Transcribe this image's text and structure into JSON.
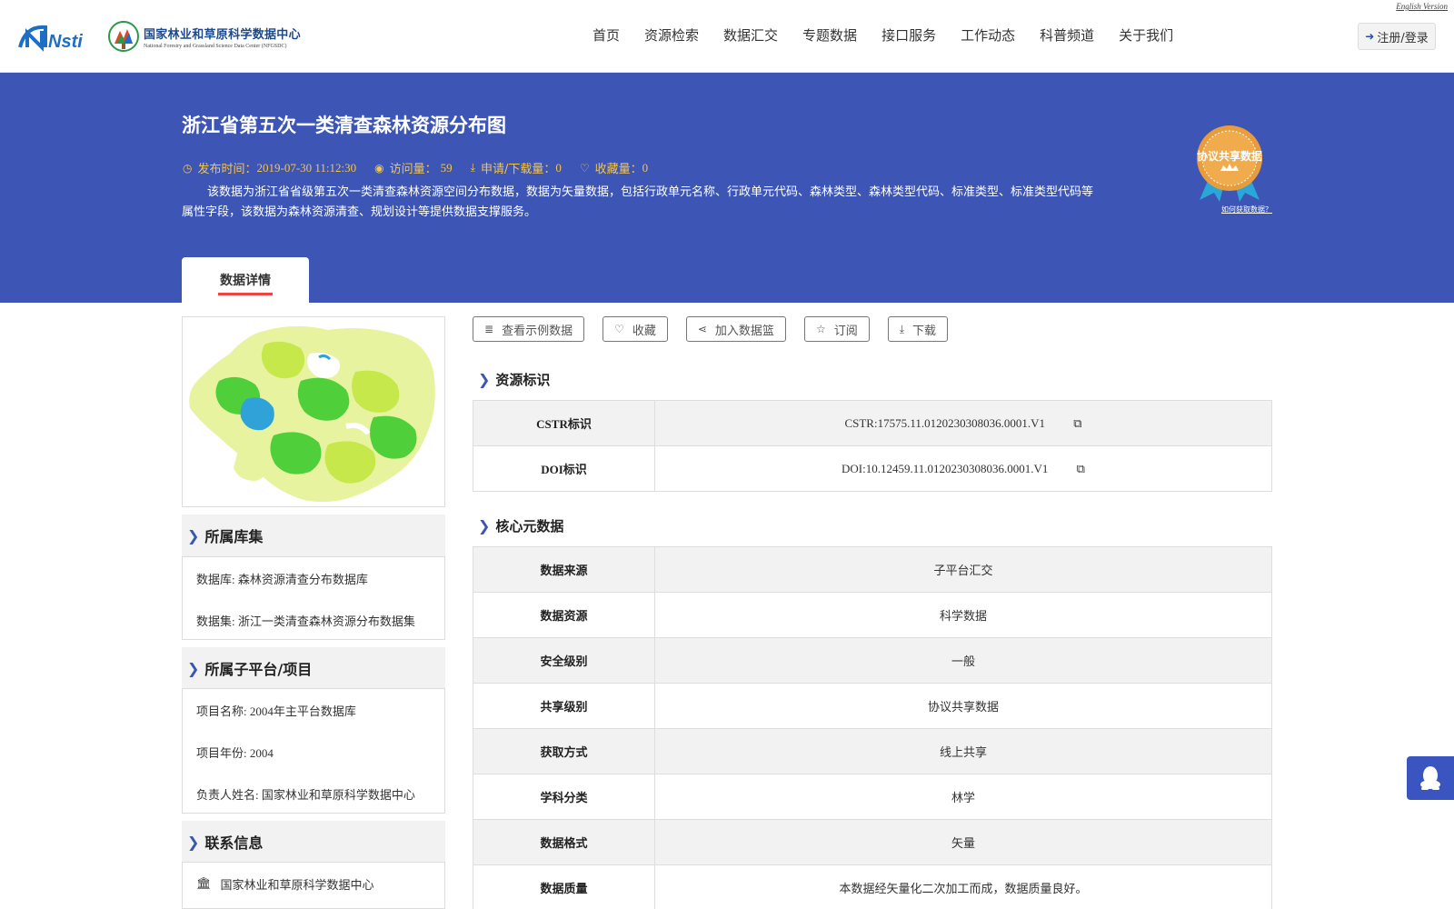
{
  "header": {
    "logo_text": "Nsti",
    "org_cn": "国家林业和草原科学数据中心",
    "org_en": "National Forestry and Grassland Science Data Center (NFGSDC)",
    "english_link": "English Version",
    "login_label": "注册/登录",
    "nav": [
      "首页",
      "资源检索",
      "数据汇交",
      "专题数据",
      "接口服务",
      "工作动态",
      "科普频道",
      "关于我们"
    ]
  },
  "banner": {
    "title": "浙江省第五次一类清查森林资源分布图",
    "publish_label": "发布时间：",
    "publish_time": "2019-07-30 11:12:30",
    "visits_label": "访问量：",
    "visits": "59",
    "downloads_label": "申请/下载量：",
    "downloads": "0",
    "favorites_label": "收藏量：",
    "favorites": "0",
    "description": "该数据为浙江省省级第五次一类清查森林资源空间分布数据，数据为矢量数据，包括行政单元名称、行政单元代码、森林类型、森林类型代码、标准类型、标准类型代码等属性字段，该数据为森林资源清查、规划设计等提供数据支撑服务。",
    "badge_label": "协议共享数据",
    "badge_link": "如何获取数据？",
    "tab_label": "数据详情"
  },
  "actions": [
    "查看示例数据",
    "收藏",
    "加入数据篮",
    "订阅",
    "下载"
  ],
  "sidebar": {
    "collection_title": "所属库集",
    "collection": [
      "数据库: 森林资源清查分布数据库",
      "数据集: 浙江一类清查森林资源分布数据集"
    ],
    "project_title": "所属子平台/项目",
    "project": [
      "项目名称: 2004年主平台数据库",
      "项目年份: 2004",
      "负责人姓名: 国家林业和草原科学数据中心"
    ],
    "contact_title": "联系信息",
    "contact_org": "国家林业和草原科学数据中心"
  },
  "resource_id": {
    "title": "资源标识",
    "rows": [
      {
        "key": "CSTR标识",
        "value": "CSTR:17575.11.0120230308036.0001.V1"
      },
      {
        "key": "DOI标识",
        "value": "DOI:10.12459.11.0120230308036.0001.V1"
      }
    ]
  },
  "core_meta": {
    "title": "核心元数据",
    "rows": [
      {
        "key": "数据来源",
        "value": "子平台汇交"
      },
      {
        "key": "数据资源",
        "value": "科学数据"
      },
      {
        "key": "安全级别",
        "value": "一般"
      },
      {
        "key": "共享级别",
        "value": "协议共享数据"
      },
      {
        "key": "获取方式",
        "value": "线上共享"
      },
      {
        "key": "学科分类",
        "value": "林学"
      },
      {
        "key": "数据格式",
        "value": "矢量"
      },
      {
        "key": "数据质量",
        "value": "本数据经矢量化二次加工而成，数据质量良好。"
      }
    ]
  },
  "colors": {
    "banner": "#3d56b6",
    "meta_yellow": "#f5c546",
    "accent_red": "#e44444"
  }
}
